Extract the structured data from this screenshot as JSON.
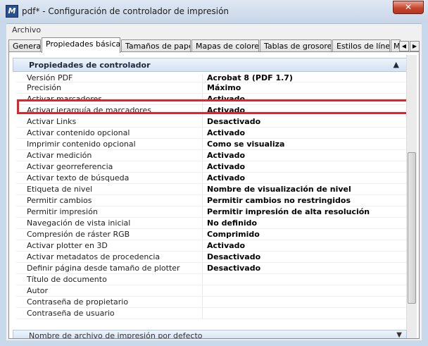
{
  "window": {
    "title": "pdf* - Configuración de controlador de impresión",
    "close_label": "✕"
  },
  "menu": {
    "file": "Archivo"
  },
  "tabs": [
    {
      "label": "General"
    },
    {
      "label": "Propiedades básicas",
      "active": true
    },
    {
      "label": "Tamaños de papel"
    },
    {
      "label": "Mapas de colores"
    },
    {
      "label": "Tablas de grosores"
    },
    {
      "label": "Estilos de línea"
    },
    {
      "label": "M"
    }
  ],
  "section": {
    "title": "Propiedades de controlador"
  },
  "properties": [
    {
      "key": "Versión PDF",
      "value": "Acrobat 8 (PDF 1.7)"
    },
    {
      "key": "Precisión",
      "value": "Máximo"
    },
    {
      "key": "Activar marcadores",
      "value": "Activado"
    },
    {
      "key": "Activar jerarquía de marcadores",
      "value": "Activado"
    },
    {
      "key": "Activar Links",
      "value": "Desactivado"
    },
    {
      "key": "Activar contenido opcional",
      "value": "Activado"
    },
    {
      "key": "Imprimir contenido opcional",
      "value": "Como se visualiza"
    },
    {
      "key": "Activar medición",
      "value": "Activado"
    },
    {
      "key": "Activar georreferencia",
      "value": "Activado"
    },
    {
      "key": "Activar texto de búsqueda",
      "value": "Activado"
    },
    {
      "key": "Etiqueta de nivel",
      "value": "Nombre de visualización de nivel"
    },
    {
      "key": "Permitir cambios",
      "value": "Permitir cambios no restringidos"
    },
    {
      "key": "Permitir impresión",
      "value": "Permitir impresión de alta resolución"
    },
    {
      "key": "Navegación de vista inicial",
      "value": "No definido"
    },
    {
      "key": "Compresión de ráster RGB",
      "value": "Comprimido"
    },
    {
      "key": "Activar plotter en 3D",
      "value": "Activado"
    },
    {
      "key": "Activar metadatos de procedencia",
      "value": "Desactivado"
    },
    {
      "key": "Definir página desde tamaño de plotter",
      "value": "Desactivado"
    },
    {
      "key": "Título de documento",
      "value": ""
    },
    {
      "key": "Autor",
      "value": ""
    },
    {
      "key": "Contraseña de propietario",
      "value": ""
    },
    {
      "key": "Contraseña de usuario",
      "value": ""
    }
  ],
  "section2": {
    "title": "Nombre de archivo de impresión por defecto"
  },
  "colors": {
    "highlight": "#e0242b"
  }
}
